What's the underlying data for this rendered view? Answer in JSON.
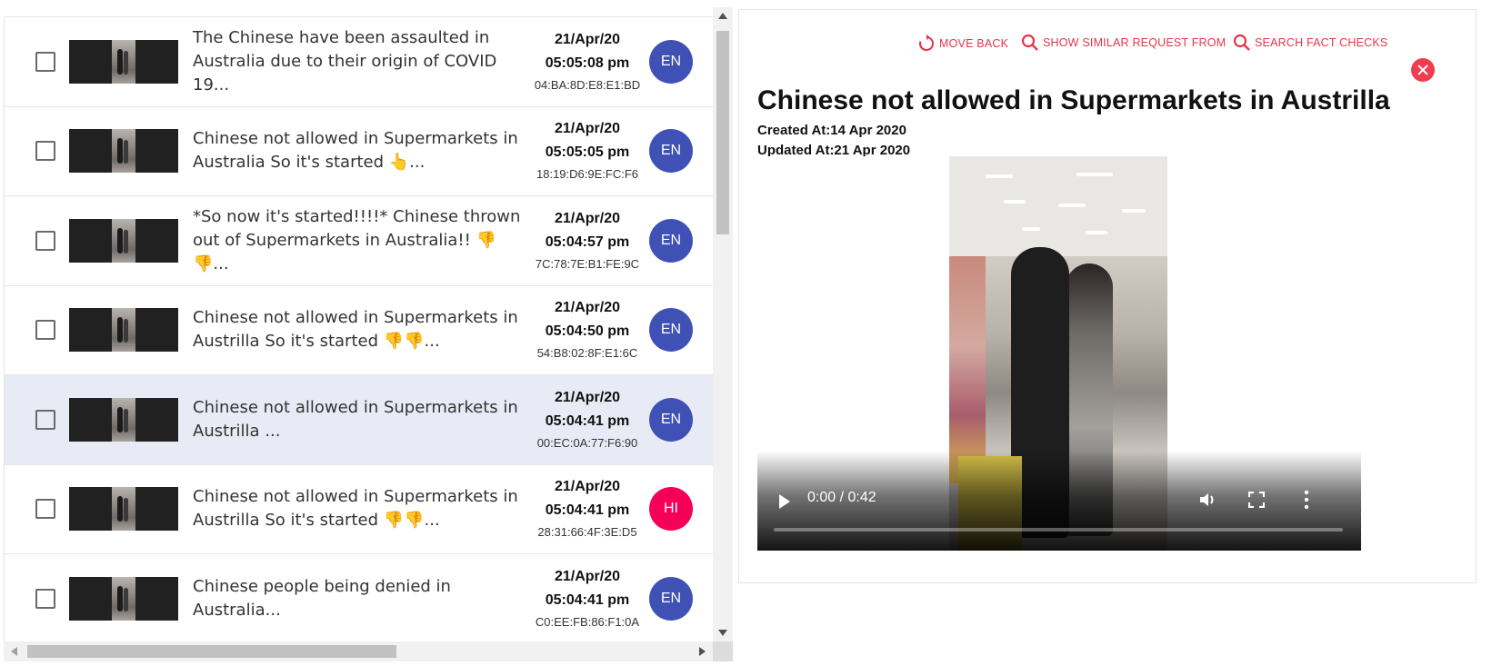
{
  "rows": [
    {
      "title": "The Chinese have been assaulted in Australia due to their origin of COVID 19...",
      "date": "21/Apr/20",
      "time": "05:05:08 pm",
      "mac": "04:BA:8D:E8:E1:BD",
      "lang": "EN",
      "lang_color": "#3f51b5",
      "selected": false
    },
    {
      "title": "Chinese not allowed in Supermarkets in Australia So it's started 👆...",
      "date": "21/Apr/20",
      "time": "05:05:05 pm",
      "mac": "18:19:D6:9E:FC:F6",
      "lang": "EN",
      "lang_color": "#3f51b5",
      "selected": false
    },
    {
      "title": "*So now it's started!!!!* Chinese thrown out of Supermarkets in Australia!! 👎👎...",
      "date": "21/Apr/20",
      "time": "05:04:57 pm",
      "mac": "7C:78:7E:B1:FE:9C",
      "lang": "EN",
      "lang_color": "#3f51b5",
      "selected": false
    },
    {
      "title": "Chinese not allowed in Supermarkets in Austrilla So it's started 👎👎...",
      "date": "21/Apr/20",
      "time": "05:04:50 pm",
      "mac": "54:B8:02:8F:E1:6C",
      "lang": "EN",
      "lang_color": "#3f51b5",
      "selected": false
    },
    {
      "title": "Chinese not allowed in Supermarkets in Austrilla ...",
      "date": "21/Apr/20",
      "time": "05:04:41 pm",
      "mac": "00:EC:0A:77:F6:90",
      "lang": "EN",
      "lang_color": "#3f51b5",
      "selected": true
    },
    {
      "title": "Chinese not allowed in Supermarkets in Austrilla So it's started 👎👎...",
      "date": "21/Apr/20",
      "time": "05:04:41 pm",
      "mac": "28:31:66:4F:3E:D5",
      "lang": "HI",
      "lang_color": "#f50057",
      "selected": false
    },
    {
      "title": "Chinese people being denied in Australia...",
      "date": "21/Apr/20",
      "time": "05:04:41 pm",
      "mac": "C0:EE:FB:86:F1:0A",
      "lang": "EN",
      "lang_color": "#3f51b5",
      "selected": false
    }
  ],
  "detail": {
    "toolbar": {
      "move_back": "MOVE BACK",
      "show_similar": "SHOW SIMILAR REQUEST FROM",
      "search_fact": "SEARCH FACT CHECKS",
      "accent_color": "#e8344a"
    },
    "title": "Chinese not allowed in Supermarkets in Austrilla",
    "created": "Created At:14 Apr 2020",
    "updated": "Updated At:21 Apr 2020",
    "video": {
      "time": "0:00 / 0:42",
      "progress": 0
    }
  }
}
